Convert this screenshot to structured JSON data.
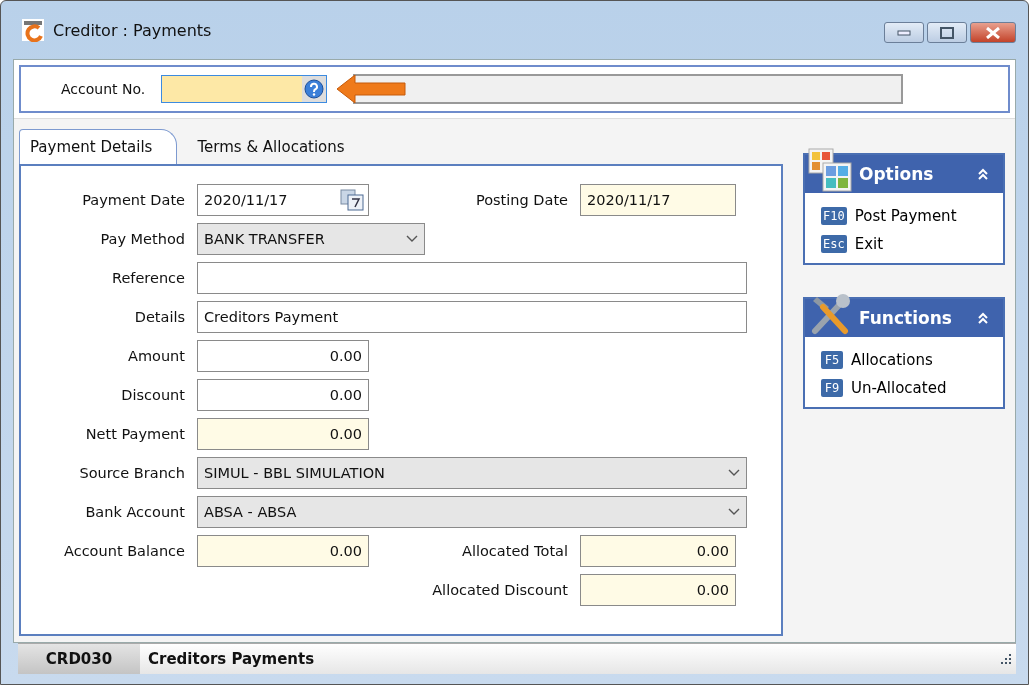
{
  "window": {
    "title": "Creditor : Payments"
  },
  "account": {
    "label": "Account No."
  },
  "tabs": [
    {
      "label": "Payment Details",
      "selected": true
    },
    {
      "label": "Terms & Allocations",
      "selected": false
    }
  ],
  "rows": [
    {
      "left": {
        "label": "Payment Date",
        "value": "2020/11/17",
        "kind": "date",
        "readonly": false
      },
      "right": {
        "label": "Posting Date",
        "value": "2020/11/17",
        "kind": "text",
        "readonly": true
      }
    },
    {
      "left": {
        "label": "Pay Method",
        "value": "BANK TRANSFER",
        "kind": "combo",
        "readonly": false
      }
    },
    {
      "left": {
        "label": "Reference",
        "kind": "text",
        "readonly": false
      }
    },
    {
      "left": {
        "label": "Details",
        "value": "Creditors Payment",
        "kind": "text",
        "readonly": false
      }
    },
    {
      "left": {
        "label": "Amount",
        "value": "0.00",
        "kind": "amount",
        "readonly": false
      }
    },
    {
      "left": {
        "label": "Discount",
        "value": "0.00",
        "kind": "amount",
        "readonly": false
      }
    },
    {
      "left": {
        "label": "Nett Payment",
        "value": "0.00",
        "kind": "amount",
        "readonly": true
      }
    },
    {
      "left": {
        "label": "Source Branch",
        "value": "SIMUL - BBL SIMULATION",
        "kind": "select",
        "readonly": false
      }
    },
    {
      "left": {
        "label": "Bank Account",
        "value": "ABSA - ABSA",
        "kind": "select",
        "readonly": false
      }
    },
    {
      "left": {
        "label": "Account Balance",
        "value": "0.00",
        "kind": "amount",
        "readonly": true
      },
      "right": {
        "label": "Allocated Total",
        "value": "0.00",
        "kind": "amount",
        "readonly": true
      }
    },
    {
      "right": {
        "label": "Allocated Discount",
        "value": "0.00",
        "kind": "amount",
        "readonly": true
      }
    }
  ],
  "panels": [
    {
      "title": "Options",
      "kind": "options",
      "items": [
        {
          "key": "F10",
          "label": "Post Payment"
        },
        {
          "key": "Esc",
          "label": "Exit"
        }
      ]
    },
    {
      "title": "Functions",
      "kind": "functions",
      "items": [
        {
          "key": "F5",
          "label": "Allocations"
        },
        {
          "key": "F9",
          "label": "Un-Allocated"
        }
      ]
    }
  ],
  "status_bar": {
    "code": "CRD030",
    "title": "Creditors Payments"
  }
}
